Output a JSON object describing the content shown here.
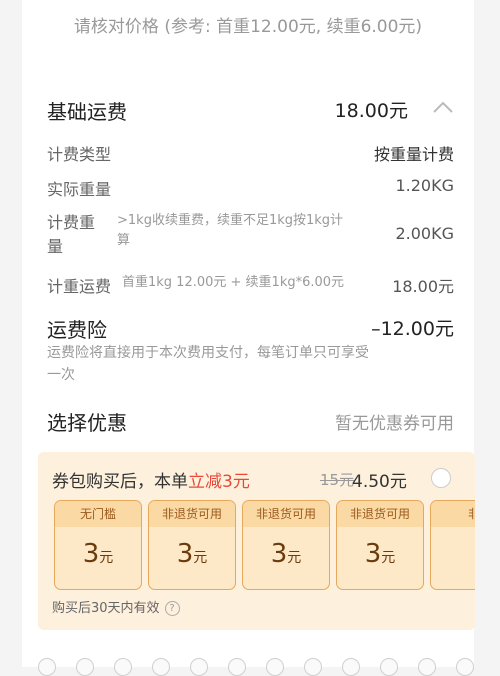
{
  "tip": "请核对价格 (参考: 首重12.00元, 续重6.00元)",
  "basic_fee": {
    "label": "基础运费",
    "value": "18.00元",
    "icon": "chevron-up-icon"
  },
  "details": [
    {
      "label": "计费类型",
      "note": "",
      "value": "按重量计费"
    },
    {
      "label": "实际重量",
      "note": "",
      "value": "1.20KG"
    },
    {
      "label_lines": [
        "计费重",
        "量"
      ],
      "note_lines": [
        ">1kg收续重费，续重不足1kg按1kg计",
        "算"
      ],
      "value": "2.00KG"
    },
    {
      "label": "计重运费",
      "note": "首重1kg 12.00元 + 续重1kg*6.00元",
      "value": "18.00元"
    }
  ],
  "insurance": {
    "label": "运费险",
    "value": "–12.00元",
    "desc_lines": [
      "运费险将直接用于本次费用支付，每笔订单只可享受",
      "一次"
    ]
  },
  "discount": {
    "label": "选择优惠",
    "value": "暂无优惠券可用"
  },
  "coupon_pack": {
    "title_prefix": "券包购买后，本单",
    "title_highlight": "立减3元",
    "original_price": "15元",
    "price": "4.50元",
    "tickets": [
      {
        "head": "无门槛",
        "amount": "3",
        "unit": "元"
      },
      {
        "head": "非退货可用",
        "amount": "3",
        "unit": "元"
      },
      {
        "head": "非退货可用",
        "amount": "3",
        "unit": "元"
      },
      {
        "head": "非退货可用",
        "amount": "3",
        "unit": "元"
      },
      {
        "head": "非",
        "amount": "",
        "unit": ""
      }
    ],
    "validity": "购买后30天内有效",
    "help_icon": "question-icon"
  }
}
